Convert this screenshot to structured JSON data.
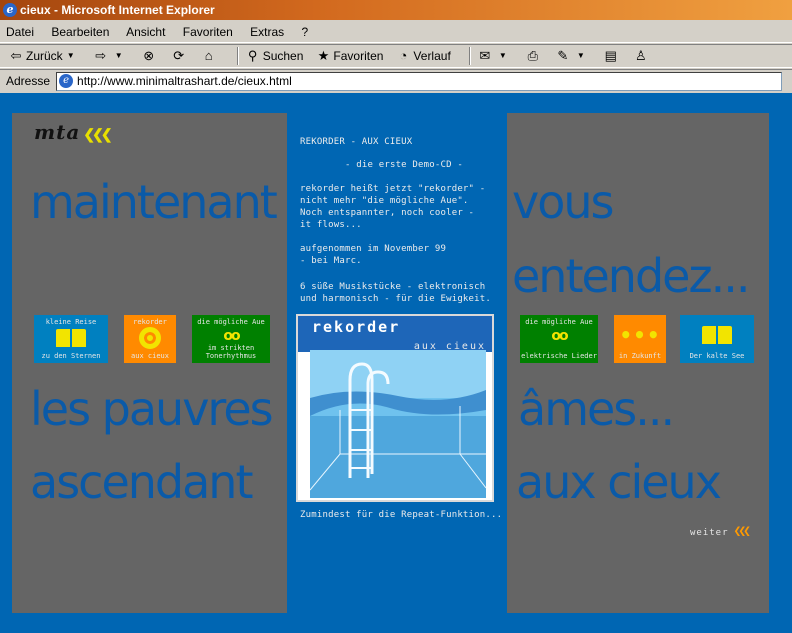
{
  "window": {
    "title": "cieux - Microsoft Internet Explorer"
  },
  "menu": {
    "items": [
      "Datei",
      "Bearbeiten",
      "Ansicht",
      "Favoriten",
      "Extras",
      "?"
    ]
  },
  "toolbar": {
    "back": "Zurück",
    "search": "Suchen",
    "favorites": "Favoriten",
    "history": "Verlauf"
  },
  "address": {
    "label": "Adresse",
    "url": "http://www.minimaltrashart.de/cieux.html"
  },
  "page": {
    "logo": "mta",
    "words": {
      "w1": "maintenant",
      "w2": "vous",
      "w3": "entendez...",
      "w4": "les pauvres",
      "w5": "âmes...",
      "w6": "ascendant",
      "w7": "aux cieux"
    },
    "nav": [
      {
        "top": "kleine Reise",
        "bottom": "zu den Sternen",
        "icon": "book-icon"
      },
      {
        "top": "rekorder",
        "bottom": "aux cieux",
        "icon": "cd-icon"
      },
      {
        "top": "die mögliche Aue",
        "bottom": "im strikten Tonerhythmus",
        "icon": "tape-icon"
      },
      {
        "top": "die mögliche Aue",
        "bottom": "elektrische Lieder",
        "icon": "tape-icon"
      },
      {
        "top": "",
        "bottom": "in Zukunft",
        "icon": "dots-icon"
      },
      {
        "top": "",
        "bottom": "Der kalte See",
        "icon": "book-icon"
      }
    ],
    "center": {
      "heading": "REKORDER - AUX CIEUX",
      "sub": "- die erste Demo-CD -",
      "p1": "rekorder heißt jetzt \"rekorder\" -\nnicht mehr \"die mögliche Aue\".\nNoch entspannter, noch cooler -\nit flows...",
      "p2": "aufgenommen im November 99\n- bei Marc.",
      "p3": "6 süße Musikstücke - elektronisch\nund harmonisch - für die Ewigkeit.",
      "cover_title": "rekorder",
      "cover_sub": "aux cieux",
      "caption": "Zumindest für die Repeat-Funktion..."
    },
    "weiter": "weiter"
  },
  "colors": {
    "page_bg": "#0066b3",
    "panel": "#656565",
    "big_text": "#0a5aa8",
    "accent_yellow": "#f2e400",
    "accent_orange": "#ff8a00",
    "nav_blue": "#0080c0",
    "nav_green": "#008000"
  }
}
